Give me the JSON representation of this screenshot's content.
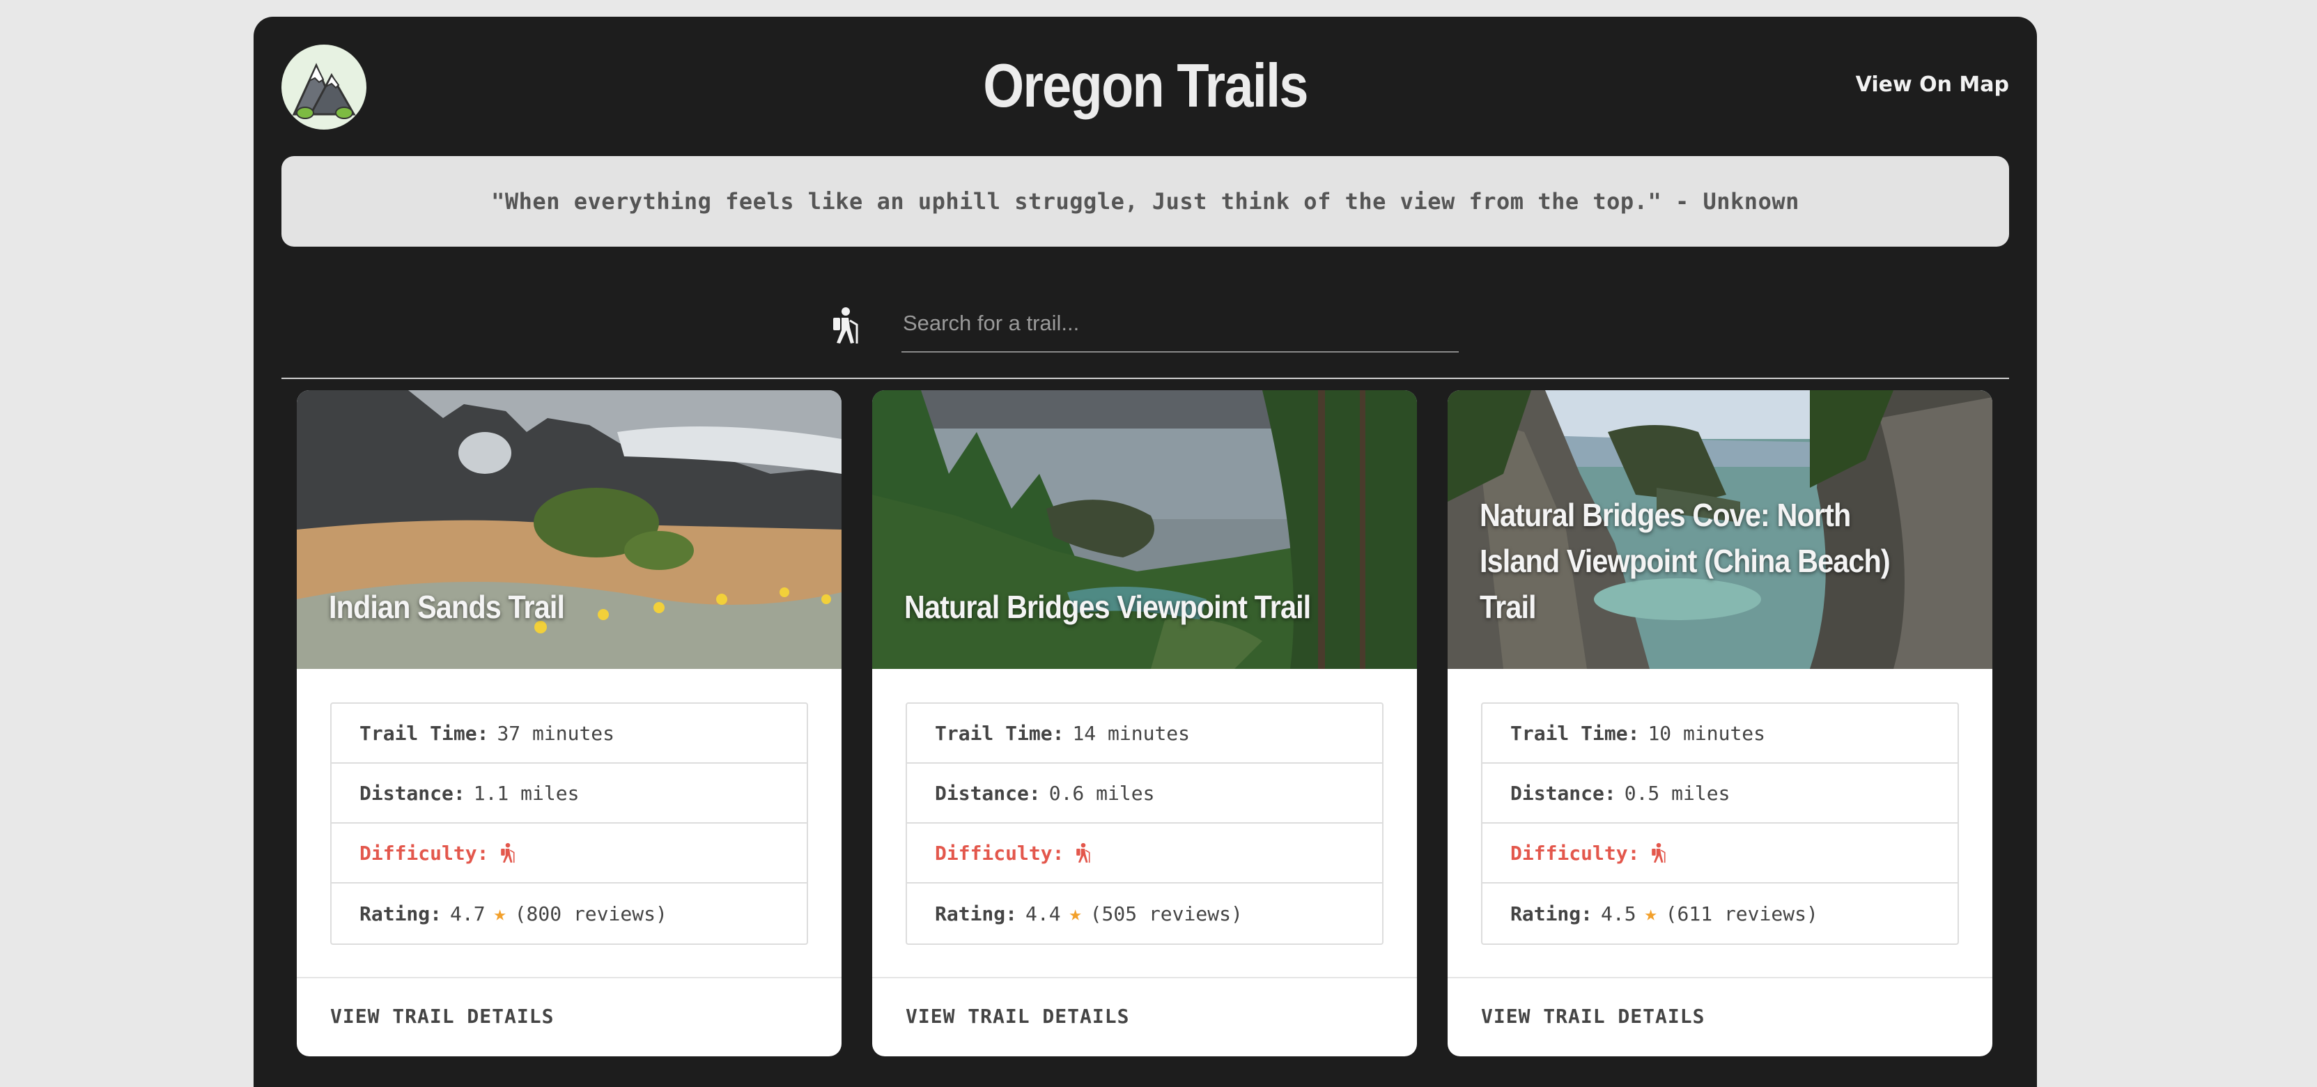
{
  "header": {
    "title": "Oregon Trails",
    "map_link": "View On Map"
  },
  "quote": "\"When everything feels like an uphill struggle, Just think of the view from the top.\" - Unknown",
  "search": {
    "placeholder": "Search for a trail..."
  },
  "labels": {
    "trail_time": "Trail Time:",
    "distance": "Distance:",
    "difficulty": "Difficulty:",
    "rating": "Rating:",
    "details": "VIEW TRAIL DETAILS"
  },
  "colors": {
    "background": "#1d1d1d",
    "difficulty": "#e3574c",
    "star": "#f2a02b"
  },
  "trails": [
    {
      "name": "Indian Sands Trail",
      "time": "37 minutes",
      "distance": "1.1 miles",
      "difficulty_level": 1,
      "rating": "4.7",
      "reviews": "(800 reviews)"
    },
    {
      "name": "Natural Bridges Viewpoint Trail",
      "time": "14 minutes",
      "distance": "0.6 miles",
      "difficulty_level": 1,
      "rating": "4.4",
      "reviews": "(505 reviews)"
    },
    {
      "name": "Natural Bridges Cove: North Island Viewpoint (China Beach) Trail",
      "time": "10 minutes",
      "distance": "0.5 miles",
      "difficulty_level": 1,
      "rating": "4.5",
      "reviews": "(611 reviews)"
    }
  ]
}
